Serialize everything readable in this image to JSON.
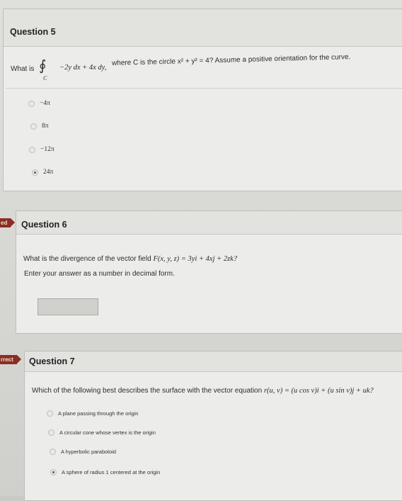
{
  "q5": {
    "title": "Question 5",
    "prefix": "What is",
    "integral": "∮",
    "subscript": "C",
    "expression": "−2y dx + 4x dy,",
    "where_text": "where C is the circle x² + y² = 4? Assume a positive orientation for the curve.",
    "options": [
      {
        "label": "−4π",
        "selected": false
      },
      {
        "label": "8π",
        "selected": false
      },
      {
        "label": "−12π",
        "selected": false
      },
      {
        "label": "24π",
        "selected": true
      }
    ]
  },
  "q6": {
    "tag": "ed",
    "title": "Question 6",
    "prompt_start": "What is the divergence of the vector field",
    "field": "F(x, y, z) = 3yi + 4xj + 2zk?",
    "instruction": "Enter your answer as a number in decimal form.",
    "answer_value": ""
  },
  "q7": {
    "tag": "rrect",
    "title": "Question 7",
    "prompt_start": "Which of the following best describes the surface with the vector equation",
    "equation": "r(u, v) = (u cos v)i + (u sin v)j + uk?",
    "options": [
      {
        "label": "A plane passing through the origin",
        "selected": false
      },
      {
        "label": "A circular cone whose vertex is the origin",
        "selected": false
      },
      {
        "label": "A hyperbolic paraboloid",
        "selected": false
      },
      {
        "label": "A sphere of radius 1 centered at the origin",
        "selected": true
      }
    ]
  }
}
